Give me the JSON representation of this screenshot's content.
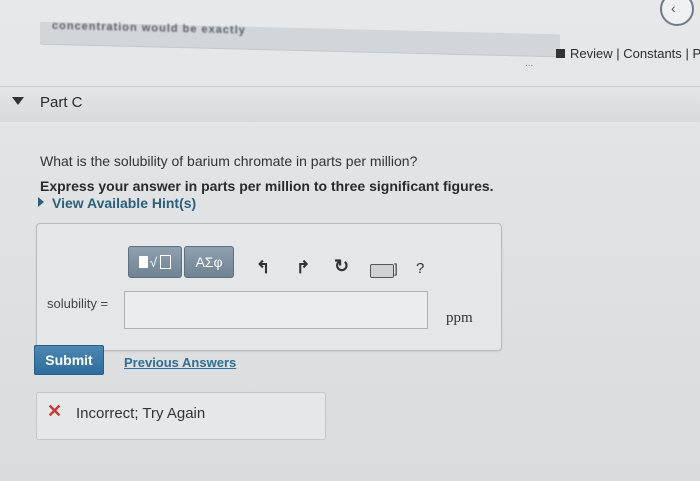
{
  "banner": {
    "partial_text": "concentration would be exactly",
    "trailing": "..."
  },
  "nav": {
    "icon": "chevron-left-icon",
    "glyph": "‹"
  },
  "review_bar": {
    "review": "Review",
    "separator": "|",
    "constants": "Constants",
    "cutoff": "Pe"
  },
  "part": {
    "title": "Part C"
  },
  "question": {
    "prompt": "What is the solubility of barium chromate in parts per million?",
    "instruction": "Express your answer in parts per million to three significant figures.",
    "hints_link": "View Available Hint(s)"
  },
  "toolbar": {
    "templates_label": "√",
    "symbols_label": "ΑΣφ",
    "undo": "↰",
    "redo": "↱",
    "reset": "↻",
    "keyboard_bracket": "]",
    "help": "?"
  },
  "answer": {
    "label": "solubility =",
    "value": "",
    "unit": "ppm"
  },
  "actions": {
    "submit_label": "Submit",
    "previous_answers_label": "Previous Answers"
  },
  "feedback": {
    "icon": "✕",
    "text": "Incorrect; Try Again",
    "status_color": "#c8372f"
  },
  "colors": {
    "accent": "#2f6d9c",
    "link": "#2e6e96",
    "toolbar_button": "#7b8fa0"
  }
}
